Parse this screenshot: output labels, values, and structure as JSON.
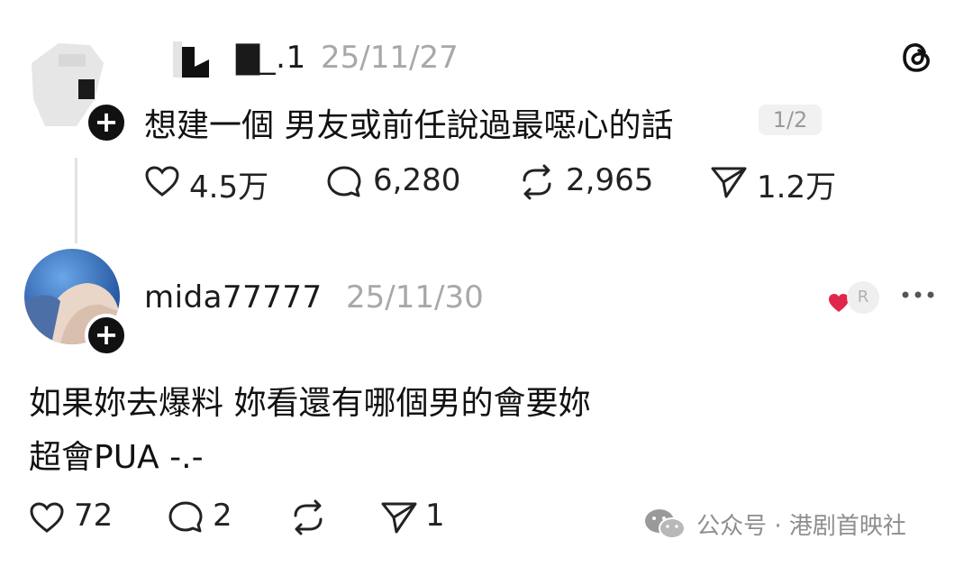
{
  "post1": {
    "username": "▇_.1",
    "date": "25/11/27",
    "text": "想建一個 男友或前任說過最噁心的話",
    "page_indicator": "1/2",
    "stats": {
      "likes": "4.5万",
      "replies": "6,280",
      "reposts": "2,965",
      "shares": "1.2万"
    }
  },
  "post2": {
    "username": "mida77777",
    "date": "25/11/30",
    "badge": "R",
    "text_line1": "如果妳去爆料 妳看還有哪個男的會要妳",
    "text_line2": "超會PUA -.-",
    "stats": {
      "likes": "72",
      "replies": "2",
      "reposts": "",
      "shares": "1"
    }
  },
  "watermark": {
    "text": "公众号 · 港剧首映社"
  },
  "icons": {
    "threads": "threads-logo-icon",
    "like": "heart-icon",
    "reply": "comment-icon",
    "repost": "repost-icon",
    "share": "send-icon",
    "more": "more-icon",
    "follow": "plus-icon"
  }
}
